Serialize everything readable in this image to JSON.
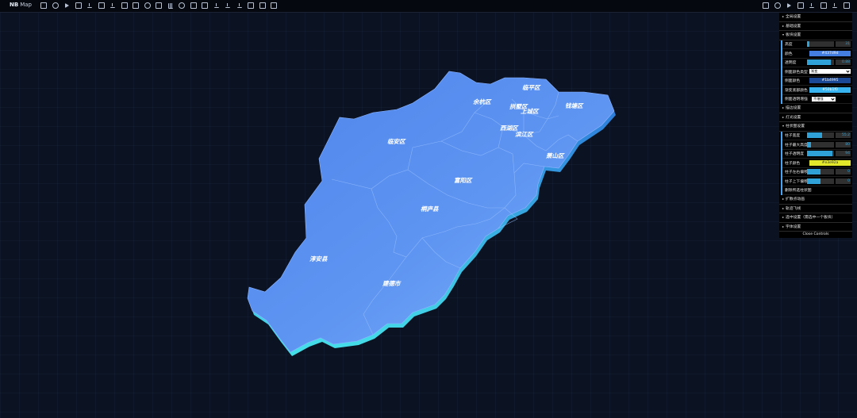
{
  "app": {
    "brand": "NB",
    "brand_sub": "Map"
  },
  "toolbar_left": [
    "home-icon",
    "grid-icon",
    "play-icon",
    "image-icon",
    "upload-icon",
    "document-icon",
    "export-icon",
    "layers-icon",
    "video-icon",
    "magnet-icon",
    "building-icon",
    "bar-chart-icon",
    "eye-icon",
    "picture-icon",
    "picture-alt-icon",
    "download-icon",
    "download-alt-icon",
    "download-file-icon",
    "save-icon",
    "file-icon",
    "mobile-icon"
  ],
  "toolbar_right": [
    "note-icon",
    "globe-icon",
    "palette-icon",
    "settings-grid-icon",
    "chat-icon",
    "comment-icon",
    "message-icon",
    "info-icon"
  ],
  "panel": {
    "sections": {
      "global": "全局设置",
      "basemap": "基础设置",
      "block": "板块设置",
      "text": "描边设置",
      "light": "灯光设置",
      "column": "柱状图设置",
      "scatter": "扩散点动画",
      "flyline": "轨迹飞线",
      "select": "选中设置（需选中一个板块）",
      "font": "字体设置"
    },
    "block_rows": {
      "height_label": "高度",
      "height_value": "31",
      "height_pct": 0.1,
      "color_label": "颜色",
      "color_value": "#437d9d",
      "opacity_label": "透明度",
      "opacity_value": "0.88",
      "opacity_pct": 0.88,
      "side_type_label": "侧面颜色类型",
      "side_type_value": "渐变",
      "side_color_label": "侧面颜色",
      "side_color_value": "#1b4995",
      "gradient_label": "渐变底部颜色",
      "gradient_value": "#50b1f0",
      "alpha_label": "侧面透明增强",
      "alpha_value": "不增强"
    },
    "column_rows": {
      "width_label": "柱子宽度",
      "width_value": "55.2",
      "width_pct": 0.55,
      "max_label": "柱子最大高度",
      "max_value": "80",
      "max_pct": 0.16,
      "transparent_label": "柱子透明度",
      "transparent_value": "94",
      "transparent_pct": 0.94,
      "color_label": "柱子颜色",
      "color_value": "#e3e92a",
      "offset_x_label": "柱子左右偏移",
      "offset_x_value": "0",
      "offset_x_pct": 0.5,
      "offset_y_label": "柱子上下偏移",
      "offset_y_value": "0",
      "offset_y_pct": 0.5,
      "delete_label": "删除所选柱状图"
    },
    "close_label": "Close Controls"
  },
  "map": {
    "labels": [
      "余杭区",
      "临平区",
      "拱墅区",
      "上城区",
      "钱塘区",
      "西湖区",
      "滨江区",
      "临安区",
      "萧山区",
      "富阳区",
      "桐庐县",
      "淳安县",
      "建德市"
    ],
    "fill_top": "#5b8ff0",
    "fill_light": "#7aaaf6",
    "side_color": "#38c7e6"
  }
}
